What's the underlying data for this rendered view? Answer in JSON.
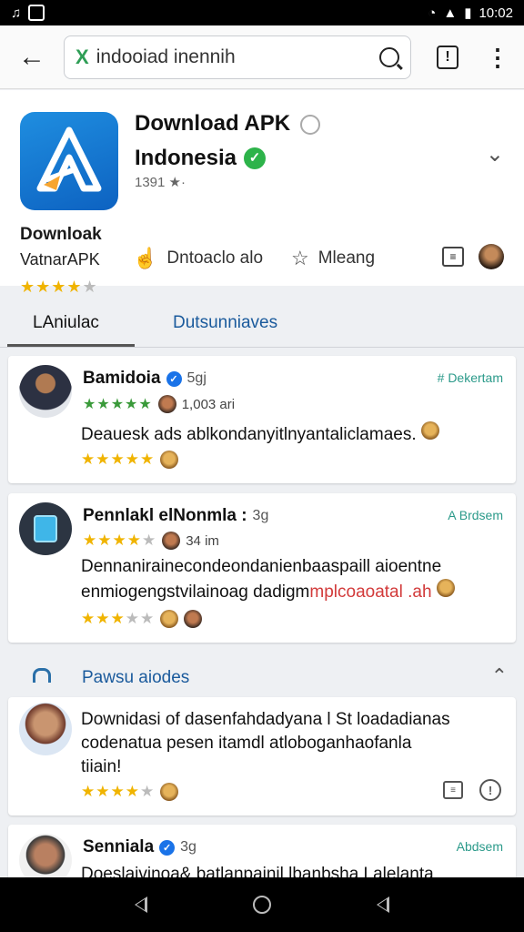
{
  "status_bar": {
    "time": "10:02"
  },
  "url_bar": {
    "text": "indooiad inennih"
  },
  "app": {
    "title_line1": "Download APK",
    "title_line2": "Indonesia",
    "meta": "1391 ★·",
    "developer": "Downloak",
    "developer_sub": "VatnarAPK",
    "actions": {
      "download": "Dntoaclo alo",
      "share": "Mleang"
    }
  },
  "tabs": [
    "LAniulac",
    "Dutsunniaves"
  ],
  "reviews": [
    {
      "name": "Bamidoia",
      "age": "5gj",
      "tag": "# Dekertam",
      "sub": "1,003 ari",
      "text_lines": [
        "Deauesk ads ablkondanyitlnyantaliclamaes."
      ]
    },
    {
      "name": "Pennlakl elNonmla :",
      "age": "3g",
      "tag": "A Brdsem",
      "sub": "34 im",
      "text_line1": "Dennanirainecondeondanienbaaspaill aioentne",
      "text_line2_plain": "enmiogengstvilainoag dadigm",
      "text_line2_highlight": "mplcoaoatal .ah"
    },
    {
      "text_lines": [
        "Downidasi of dasenfahdadyana l St loadadianas",
        "codenatua pesen itamdl atloboganhaofanla",
        "tiiain!"
      ]
    },
    {
      "name": "Senniala",
      "age": "3g",
      "tag": "Abdsem",
      "text_partial": "Doeslaivinoa& batlanpainil lbanbsha Lalelanta"
    }
  ],
  "section": {
    "title": "Pawsu aiodes"
  }
}
